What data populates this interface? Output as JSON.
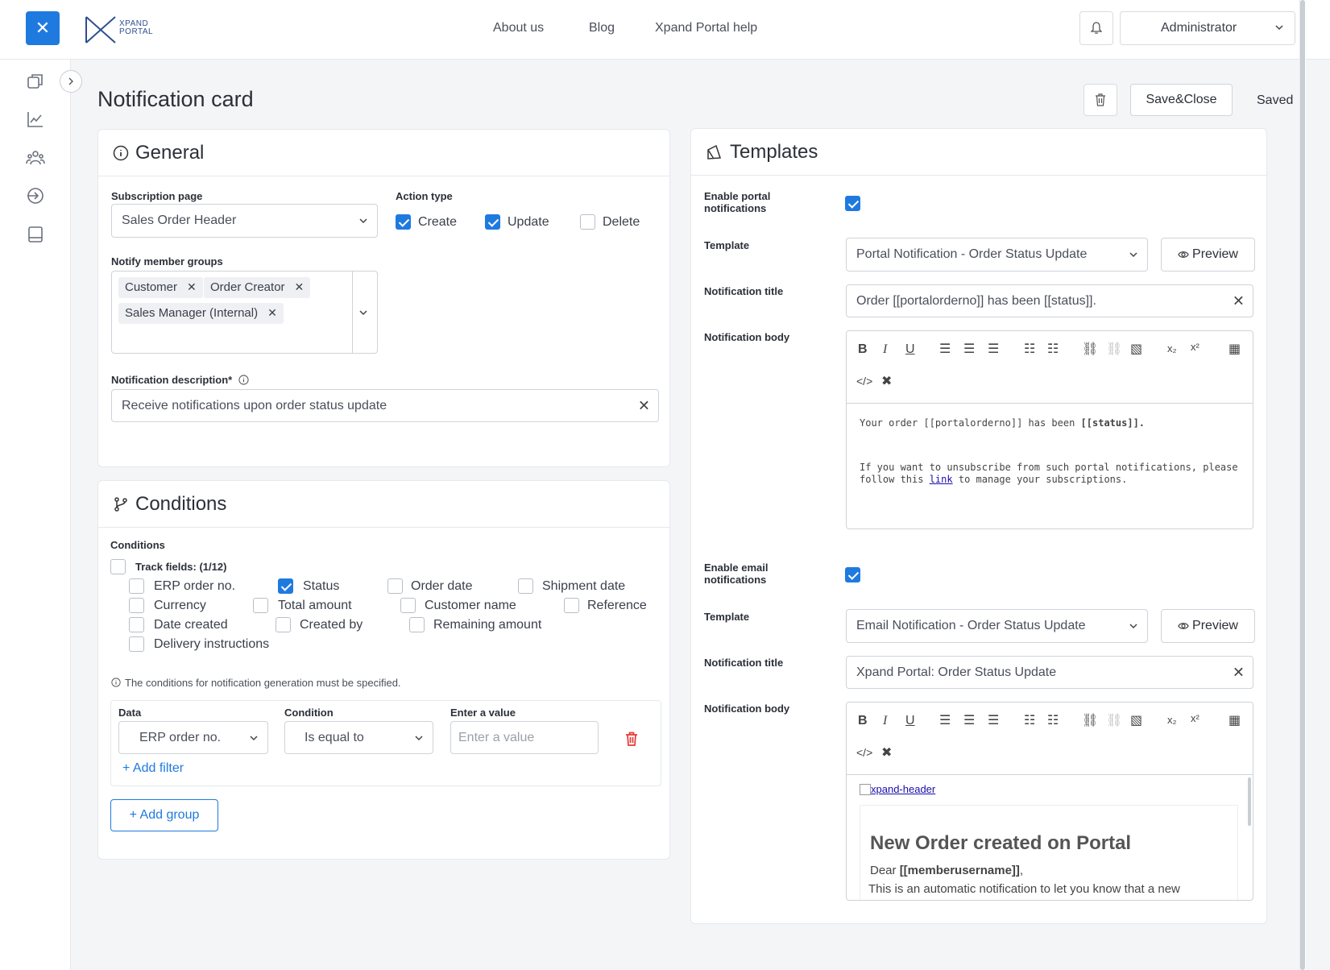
{
  "header": {
    "logo_line1": "XPAND",
    "logo_line2": "PORTAL",
    "nav": [
      "About us",
      "Blog",
      "Xpand Portal help"
    ],
    "user": "Administrator"
  },
  "page": {
    "title": "Notification card",
    "save_close": "Save&Close",
    "status": "Saved"
  },
  "general": {
    "title": "General",
    "subscription_label": "Subscription page",
    "subscription_value": "Sales Order Header",
    "action_type_label": "Action type",
    "actions": [
      {
        "label": "Create",
        "checked": true
      },
      {
        "label": "Update",
        "checked": true
      },
      {
        "label": "Delete",
        "checked": false
      }
    ],
    "groups_label": "Notify member groups",
    "groups": [
      "Customer",
      "Order Creator",
      "Sales Manager (Internal)"
    ],
    "description_label": "Notification description*",
    "description_value": "Receive notifications upon order status update"
  },
  "conditions": {
    "title": "Conditions",
    "section_label": "Conditions",
    "track_label": "Track fields: (1/12)",
    "fields": [
      {
        "label": "ERP order no.",
        "checked": false
      },
      {
        "label": "Status",
        "checked": true
      },
      {
        "label": "Order date",
        "checked": false
      },
      {
        "label": "Shipment date",
        "checked": false
      },
      {
        "label": "Currency",
        "checked": false
      },
      {
        "label": "Total amount",
        "checked": false
      },
      {
        "label": "Customer name",
        "checked": false
      },
      {
        "label": "Reference",
        "checked": false
      },
      {
        "label": "Date created",
        "checked": false
      },
      {
        "label": "Created by",
        "checked": false
      },
      {
        "label": "Remaining amount",
        "checked": false
      },
      {
        "label": "Delivery instructions",
        "checked": false
      }
    ],
    "hint": "The conditions for notification generation must be specified.",
    "data_label": "Data",
    "data_value": "ERP order no.",
    "condition_label": "Condition",
    "condition_value": "Is equal to",
    "value_label": "Enter a value",
    "value_placeholder": "Enter a value",
    "add_filter": "+ Add filter",
    "add_group": "+ Add group"
  },
  "templates": {
    "title": "Templates",
    "portal": {
      "enable_label": "Enable portal notifications",
      "enabled": true,
      "template_label": "Template",
      "template_value": "Portal Notification - Order Status Update",
      "preview": "Preview",
      "title_label": "Notification title",
      "title_value": "Order [[portalorderno]] has been [[status]].",
      "body_label": "Notification body",
      "body_line1_pre": "Your order [[portalorderno]] has been ",
      "body_line1_bold": "[[status]].",
      "body_line2_pre": "If you want to unsubscribe from such portal notifications, please follow this ",
      "body_line2_link": "link",
      "body_line2_post": "to manage your subscriptions."
    },
    "email": {
      "enable_label": "Enable email notifications",
      "enabled": true,
      "template_label": "Template",
      "template_value": "Email Notification - Order Status Update",
      "preview": "Preview",
      "title_label": "Notification title",
      "title_value": "Xpand Portal: Order Status Update",
      "body_label": "Notification body",
      "img_alt": "xpand-header",
      "heading": "New Order created on Portal",
      "dear_pre": "Dear ",
      "dear_bold": "[[memberusername]]",
      "dear_post": ",",
      "intro": "This is an automatic notification to let you know that a new"
    }
  }
}
